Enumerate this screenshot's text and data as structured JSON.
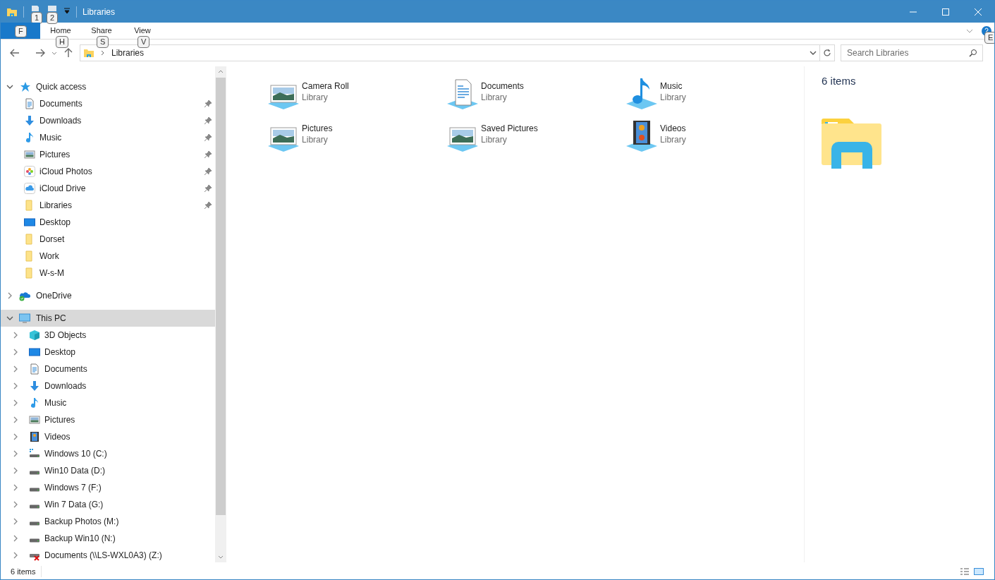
{
  "window": {
    "title": "Libraries"
  },
  "quick_access_toolbar": {
    "keytips": [
      "1",
      "2"
    ]
  },
  "ribbon": {
    "file_keytip": "F",
    "tabs": [
      {
        "label": "Home",
        "keytip": "H",
        "selected": false
      },
      {
        "label": "Share",
        "keytip": "S",
        "selected": false
      },
      {
        "label": "View",
        "keytip": "V",
        "selected": false
      }
    ],
    "help_keytip": "E"
  },
  "address_bar": {
    "crumbs": [
      "Libraries"
    ]
  },
  "search": {
    "placeholder": "Search Libraries"
  },
  "navigation": [
    {
      "label": "Quick access",
      "kind": "star",
      "expanded": true,
      "selected": false,
      "children": [
        {
          "label": "Documents",
          "kind": "documents",
          "pinned": true,
          "selected": false
        },
        {
          "label": "Downloads",
          "kind": "downloads",
          "pinned": true,
          "selected": false
        },
        {
          "label": "Music",
          "kind": "music",
          "pinned": true,
          "selected": false
        },
        {
          "label": "Pictures",
          "kind": "pictures",
          "pinned": true,
          "selected": false
        },
        {
          "label": "iCloud Photos",
          "kind": "photos",
          "pinned": true,
          "selected": false
        },
        {
          "label": "iCloud Drive",
          "kind": "cloud",
          "pinned": true,
          "selected": false
        },
        {
          "label": "Libraries",
          "kind": "folder",
          "pinned": true,
          "selected": false
        },
        {
          "label": "Desktop",
          "kind": "desktop",
          "pinned": false,
          "selected": false
        },
        {
          "label": "Dorset",
          "kind": "folder",
          "pinned": false,
          "selected": false
        },
        {
          "label": "Work",
          "kind": "folder",
          "pinned": false,
          "selected": false
        },
        {
          "label": "W-s-M",
          "kind": "folder",
          "pinned": false,
          "selected": false
        }
      ]
    },
    {
      "label": "OneDrive",
      "kind": "onedrive",
      "expanded": false,
      "selected": false
    },
    {
      "label": "This PC",
      "kind": "pc",
      "expanded": true,
      "selected": true,
      "children": [
        {
          "label": "3D Objects",
          "kind": "objects",
          "expanded": false,
          "selected": false
        },
        {
          "label": "Desktop",
          "kind": "desktop",
          "expanded": false,
          "selected": false
        },
        {
          "label": "Documents",
          "kind": "documents",
          "expanded": false,
          "selected": false
        },
        {
          "label": "Downloads",
          "kind": "downloads",
          "expanded": false,
          "selected": false
        },
        {
          "label": "Music",
          "kind": "music",
          "expanded": false,
          "selected": false
        },
        {
          "label": "Pictures",
          "kind": "pictures",
          "expanded": false,
          "selected": false
        },
        {
          "label": "Videos",
          "kind": "videos",
          "expanded": false,
          "selected": false
        },
        {
          "label": "Windows 10 (C:)",
          "kind": "windrive",
          "expanded": false,
          "selected": false
        },
        {
          "label": "Win10 Data (D:)",
          "kind": "drive",
          "expanded": false,
          "selected": false
        },
        {
          "label": "Windows 7 (F:)",
          "kind": "drive",
          "expanded": false,
          "selected": false
        },
        {
          "label": "Win 7 Data (G:)",
          "kind": "drive",
          "expanded": false,
          "selected": false
        },
        {
          "label": "Backup Photos (M:)",
          "kind": "drive",
          "expanded": false,
          "selected": false
        },
        {
          "label": "Backup Win10 (N:)",
          "kind": "drive",
          "expanded": false,
          "selected": false
        },
        {
          "label": "Documents (\\\\LS-WXL0A3) (Z:)",
          "kind": "netdrive",
          "expanded": false,
          "selected": false
        }
      ]
    }
  ],
  "libraries": [
    {
      "name": "Camera Roll",
      "type": "Library",
      "kind": "pictures"
    },
    {
      "name": "Documents",
      "type": "Library",
      "kind": "documents"
    },
    {
      "name": "Music",
      "type": "Library",
      "kind": "music"
    },
    {
      "name": "Pictures",
      "type": "Library",
      "kind": "pictures"
    },
    {
      "name": "Saved Pictures",
      "type": "Library",
      "kind": "pictures"
    },
    {
      "name": "Videos",
      "type": "Library",
      "kind": "videos"
    }
  ],
  "details_pane": {
    "count": "6 items"
  },
  "status_bar": {
    "text": "6 items"
  }
}
